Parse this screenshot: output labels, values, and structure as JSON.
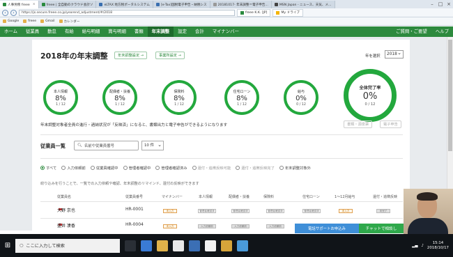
{
  "browser": {
    "tabs": [
      {
        "label": "人事労務 freee",
        "active": true
      },
      {
        "label": "freee | 全自動のクラウド会計ソ",
        "active": false
      },
      {
        "label": "eLTAX 地方税ポータルシステム",
        "active": false
      },
      {
        "label": "[e-Tax]国税電子申告・納税シス",
        "active": false
      },
      {
        "label": "20181017- 年末調整＝電子申告...",
        "active": false
      },
      {
        "label": "MSN Japan - ニュース、天気、メ...",
        "active": false
      }
    ],
    "url": "https://js.secure.freee.co.jp/yearend_adjustment/#/2018",
    "second_tab": "freee K.K. [JP]",
    "third_tab": "My ドライブ",
    "favorites": [
      "Google",
      "freee",
      "Gmail",
      "カレンダー"
    ]
  },
  "appnav": {
    "items": [
      "ホーム",
      "従業員",
      "勤怠",
      "有給",
      "給与明細",
      "賞与明細",
      "書類",
      "年末調整",
      "設定",
      "会計",
      "マイナンバー"
    ],
    "active": "年末調整",
    "right": [
      "ご質問・ご要望",
      "ヘルプ"
    ]
  },
  "header": {
    "title": "2018年の年末調整",
    "settings_button": "年末調整設定 →",
    "office_button": "事業所設定 →",
    "year_label": "年を選択",
    "year_value": "2018"
  },
  "progress": [
    {
      "label": "本人情報",
      "pct": "8%",
      "count": "1 / 12"
    },
    {
      "label": "配偶者・扶養",
      "pct": "8%",
      "count": "1 / 12"
    },
    {
      "label": "保険料",
      "pct": "8%",
      "count": "1 / 12"
    },
    {
      "label": "住宅ローン",
      "pct": "8%",
      "count": "1 / 12"
    },
    {
      "label": "給与",
      "pct": "0%",
      "count": "0 / 12"
    }
  ],
  "overall": {
    "label": "全体完了率",
    "pct": "0%",
    "count": "0 / 12"
  },
  "notice": "年末調整対象者全員の進行・過納状況が「反映済」になると、書類出力と電子申告ができるようになります",
  "doc_buttons": [
    "書類・源泉票",
    "電子申告"
  ],
  "employees": {
    "title": "従業員一覧",
    "search_placeholder": "名前や従業員番号",
    "per_page": "10 件",
    "filters": [
      {
        "label": "すべて",
        "selected": true,
        "dim": false
      },
      {
        "label": "入力依頼前",
        "selected": false,
        "dim": false
      },
      {
        "label": "従業員確認中",
        "selected": false,
        "dim": false
      },
      {
        "label": "管理者確認中",
        "selected": false,
        "dim": false
      },
      {
        "label": "管理者確認済み",
        "selected": false,
        "dim": false
      },
      {
        "label": "還付・追徴反映可能",
        "selected": false,
        "dim": true
      },
      {
        "label": "還付・追徴反映完了",
        "selected": false,
        "dim": true
      },
      {
        "label": "年末調整対象外",
        "selected": false,
        "dim": false
      }
    ],
    "hint": "絞り込みを行うことで、一覧での入力依頼や確認、年末調整のリマインド、還付の反映ができます",
    "columns": [
      "従業員名",
      "従業員番号",
      "マイナンバー",
      "本人情報",
      "配偶者・扶養",
      "保険料",
      "住宅ローン",
      "1〜12月給与",
      "還付・追徴反映"
    ],
    "rows": [
      {
        "name": "大野 京也",
        "number": "HR-0001",
        "mynumber": "未入力",
        "cells": [
          "管理者確認済",
          "管理者確認済",
          "管理者確認済",
          "管理者確認済",
          "未入力",
          "未完了"
        ]
      },
      {
        "name": "盛井 凄香",
        "number": "HR-0004",
        "mynumber": "未入力",
        "cells": [
          "入力依頼前",
          "入力依頼前",
          "入力依頼前",
          "入力依頼前",
          "未入力",
          "未完了"
        ]
      }
    ]
  },
  "support_button": "電話サポートお申込み",
  "chat_button": "チャットで相談し",
  "taskbar": {
    "search_placeholder": "ここに入力して検索",
    "time": "15:14",
    "date": "2018/10/17"
  }
}
